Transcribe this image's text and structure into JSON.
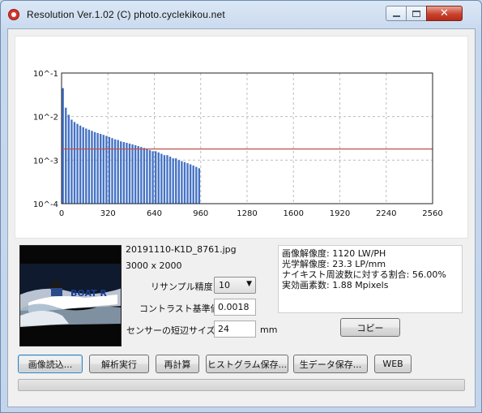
{
  "window": {
    "title": "Resolution Ver.1.02 (C) photo.cyclekikou.net"
  },
  "chart_data": {
    "type": "bar",
    "yscale": "log",
    "ylim": [
      0.0001,
      0.1
    ],
    "xlim": [
      0,
      2560
    ],
    "y_tick_labels": [
      "10^-1",
      "10^-2",
      "10^-3",
      "10^-4"
    ],
    "x_tick_labels": [
      "0",
      "320",
      "640",
      "960",
      "1280",
      "1600",
      "1920",
      "2240",
      "2560"
    ],
    "x_ticks": [
      0,
      320,
      640,
      960,
      1280,
      1600,
      1920,
      2240,
      2560
    ],
    "grid": true,
    "bar_color": "#4472c4",
    "threshold": 0.0018,
    "threshold_color": "#c0504d",
    "bar_width_units": 20,
    "x": [
      10,
      30,
      50,
      70,
      90,
      110,
      130,
      150,
      170,
      190,
      210,
      230,
      250,
      270,
      290,
      310,
      330,
      350,
      370,
      390,
      410,
      430,
      450,
      470,
      490,
      510,
      530,
      550,
      570,
      590,
      610,
      630,
      650,
      670,
      690,
      710,
      730,
      750,
      770,
      790,
      810,
      830,
      850,
      870,
      890,
      910,
      930,
      950
    ],
    "values": [
      0.045,
      0.016,
      0.011,
      0.0085,
      0.0075,
      0.0068,
      0.0062,
      0.0057,
      0.0053,
      0.005,
      0.0047,
      0.0044,
      0.0042,
      0.004,
      0.0038,
      0.0036,
      0.0034,
      0.0032,
      0.003,
      0.0029,
      0.0027,
      0.0026,
      0.0025,
      0.0024,
      0.0023,
      0.0022,
      0.0021,
      0.002,
      0.0019,
      0.0018,
      0.0017,
      0.0016,
      0.0016,
      0.0015,
      0.0014,
      0.0013,
      0.0013,
      0.0012,
      0.0011,
      0.0011,
      0.001,
      0.00095,
      0.0009,
      0.00085,
      0.0008,
      0.00075,
      0.0007,
      0.00065
    ]
  },
  "image": {
    "filename": "20191110-K1D_8761.jpg",
    "dimensions": "3000 x 2000",
    "thumbnail_text": "BOAT R"
  },
  "settings": {
    "resample_label": "リサンプル精度",
    "resample_value": "10",
    "contrast_label": "コントラスト基準値",
    "contrast_value": "0.0018",
    "sensor_label": "センサーの短辺サイズ",
    "sensor_value": "24",
    "sensor_unit": "mm"
  },
  "results": {
    "lines": [
      "画像解像度: 1120 LW/PH",
      "光学解像度: 23.3 LP/mm",
      "ナイキスト周波数に対する割合: 56.00%",
      "実効画素数: 1.88 Mpixels"
    ],
    "copy_label": "コピー"
  },
  "buttons": {
    "load": "画像読込...",
    "analyze": "解析実行",
    "recalc": "再計算",
    "save_hist": "ヒストグラム保存...",
    "save_raw": "生データ保存...",
    "web": "WEB"
  },
  "progress": {
    "value": 0
  }
}
